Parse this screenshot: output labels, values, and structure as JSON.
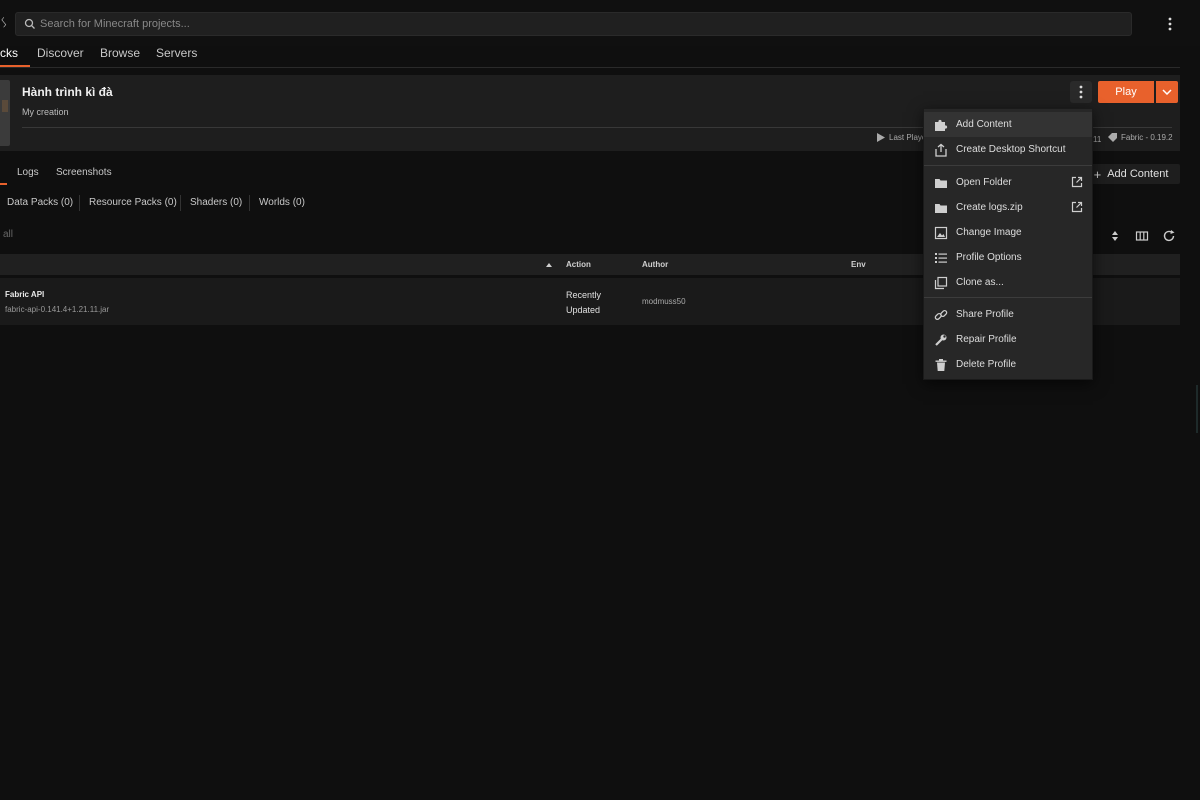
{
  "app": {
    "left_glyph": "ᛊ"
  },
  "search": {
    "placeholder": "Search for Minecraft projects..."
  },
  "main_tabs": [
    {
      "label": "cks",
      "active": true
    },
    {
      "label": "Discover",
      "active": false
    },
    {
      "label": "Browse",
      "active": false
    },
    {
      "label": "Servers",
      "active": false
    }
  ],
  "instance": {
    "title": "Hành trình kì đà",
    "subtitle": "My creation",
    "last_played": "Last Playe",
    "version_fragment": "11",
    "loader": "Fabric - 0.19.2",
    "play_label": "Play"
  },
  "sub_tabs": [
    {
      "label": "Logs"
    },
    {
      "label": "Screenshots"
    }
  ],
  "add_content_label": "Add Content",
  "filters": [
    {
      "label": "Data Packs (0)"
    },
    {
      "label": "Resource Packs (0)"
    },
    {
      "label": "Shaders (0)"
    },
    {
      "label": "Worlds (0)"
    }
  ],
  "select_all_label": "all",
  "table": {
    "headers": {
      "action": "Action",
      "author": "Author",
      "env": "Env"
    },
    "rows": [
      {
        "name": "Fabric API",
        "file": "fabric-api-0.141.4+1.21.11.jar",
        "action_line1": "Recently",
        "action_line2": "Updated",
        "author": "modmuss50"
      }
    ]
  },
  "context_menu": {
    "items": [
      {
        "label": "Add Content",
        "icon": "puzzle-icon",
        "hover": true
      },
      {
        "label": "Create Desktop Shortcut",
        "icon": "share-export-icon"
      },
      {
        "label": "Open Folder",
        "icon": "folder-icon",
        "external": true
      },
      {
        "label": "Create logs.zip",
        "icon": "folder-icon",
        "external": true
      },
      {
        "label": "Change Image",
        "icon": "image-icon"
      },
      {
        "label": "Profile Options",
        "icon": "list-icon"
      },
      {
        "label": "Clone as...",
        "icon": "clone-icon"
      },
      {
        "label": "Share Profile",
        "icon": "link-icon"
      },
      {
        "label": "Repair Profile",
        "icon": "wrench-icon"
      },
      {
        "label": "Delete Profile",
        "icon": "trash-icon"
      }
    ]
  },
  "colors": {
    "accent": "#e8612c",
    "background": "#0f0f0f",
    "panel": "#1e1e1e",
    "menu": "#272727"
  }
}
